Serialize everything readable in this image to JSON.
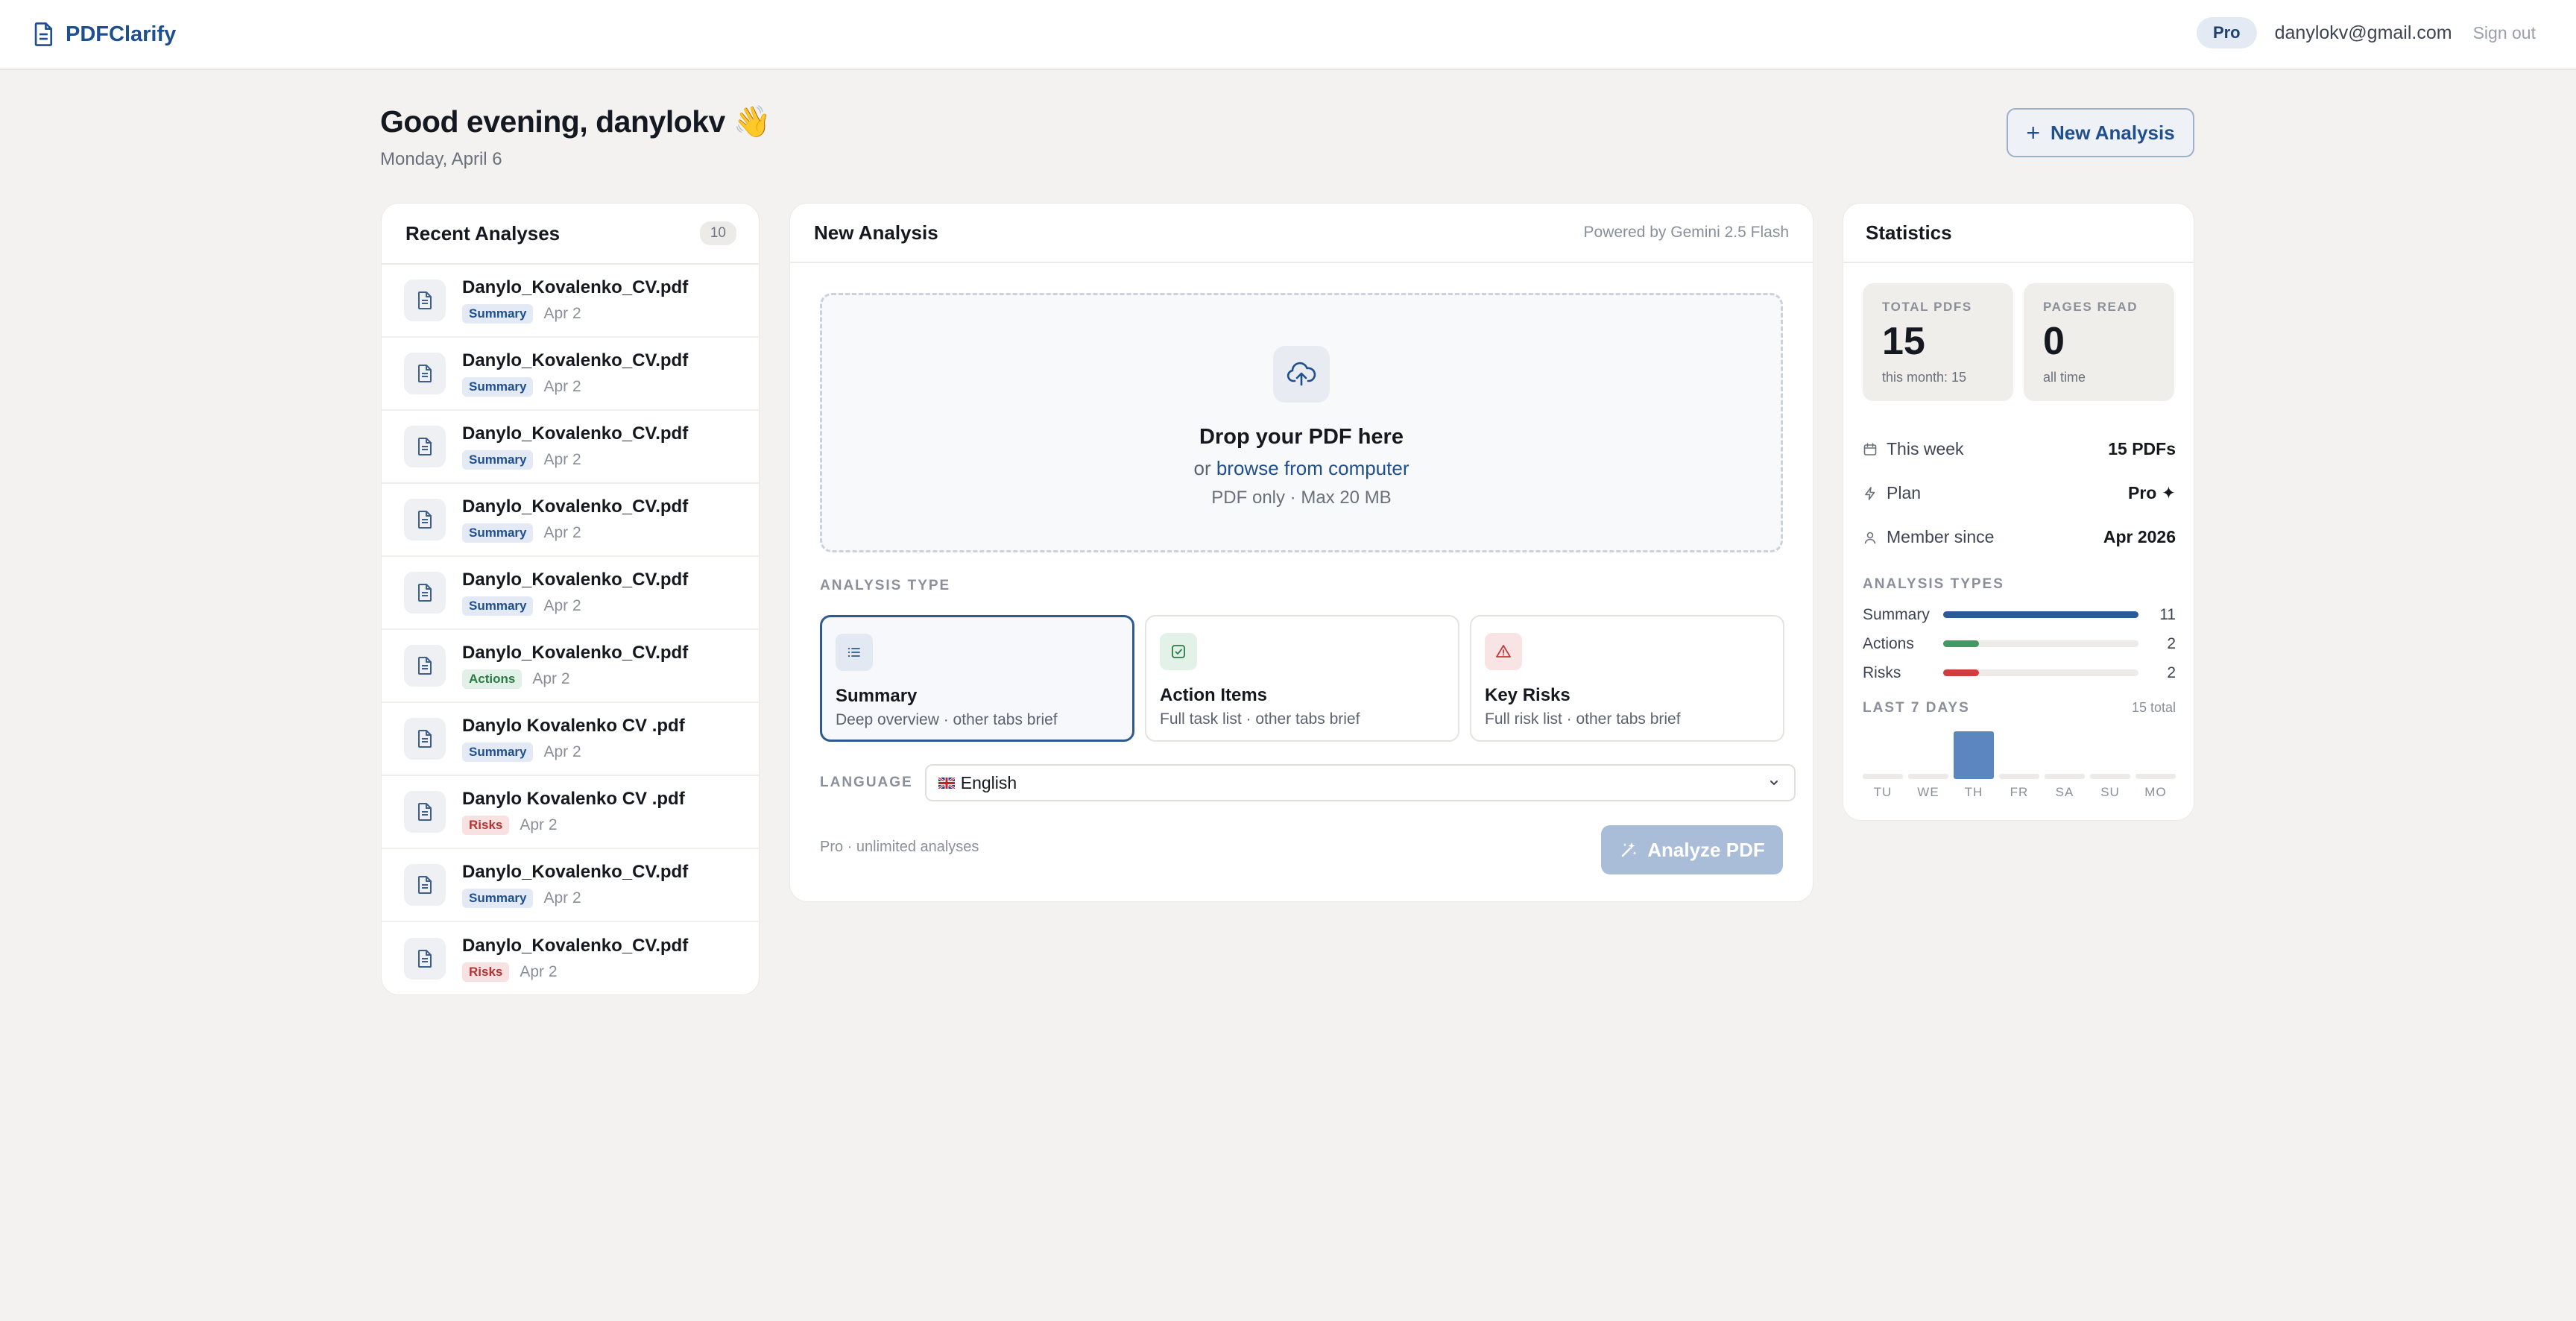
{
  "app": {
    "name": "PDFClarify"
  },
  "header": {
    "plan_badge": "Pro",
    "user_email": "danylokv@gmail.com",
    "sign_out": "Sign out"
  },
  "greeting": {
    "title": "Good evening, danylokv 👋",
    "date": "Monday, April 6"
  },
  "new_analysis_button": "New Analysis",
  "recent": {
    "title": "Recent Analyses",
    "count": "10",
    "items": [
      {
        "name": "Danylo_Kovalenko_CV.pdf",
        "tag": "Summary",
        "date": "Apr 2"
      },
      {
        "name": "Danylo_Kovalenko_CV.pdf",
        "tag": "Summary",
        "date": "Apr 2"
      },
      {
        "name": "Danylo_Kovalenko_CV.pdf",
        "tag": "Summary",
        "date": "Apr 2"
      },
      {
        "name": "Danylo_Kovalenko_CV.pdf",
        "tag": "Summary",
        "date": "Apr 2"
      },
      {
        "name": "Danylo_Kovalenko_CV.pdf",
        "tag": "Summary",
        "date": "Apr 2"
      },
      {
        "name": "Danylo_Kovalenko_CV.pdf",
        "tag": "Actions",
        "date": "Apr 2"
      },
      {
        "name": "Danylo Kovalenko CV .pdf",
        "tag": "Summary",
        "date": "Apr 2"
      },
      {
        "name": "Danylo Kovalenko CV .pdf",
        "tag": "Risks",
        "date": "Apr 2"
      },
      {
        "name": "Danylo_Kovalenko_CV.pdf",
        "tag": "Summary",
        "date": "Apr 2"
      },
      {
        "name": "Danylo_Kovalenko_CV.pdf",
        "tag": "Risks",
        "date": "Apr 2"
      }
    ]
  },
  "analysis": {
    "title": "New Analysis",
    "powered_by": "Powered by Gemini 2.5 Flash",
    "dropzone": {
      "title": "Drop your PDF here",
      "or": "or",
      "browse": "browse from computer",
      "hint": "PDF only · Max 20 MB"
    },
    "type_label": "ANALYSIS TYPE",
    "types": [
      {
        "name": "Summary",
        "desc": "Deep overview · other tabs brief",
        "icon": "list-icon",
        "selected": true
      },
      {
        "name": "Action Items",
        "desc": "Full task list · other tabs brief",
        "icon": "checkbox-icon",
        "selected": false
      },
      {
        "name": "Key Risks",
        "desc": "Full risk list · other tabs brief",
        "icon": "warning-icon",
        "selected": false
      }
    ],
    "language_label": "LANGUAGE",
    "language_value": "English",
    "plan_note": "Pro · unlimited analyses",
    "analyze_button": "Analyze PDF"
  },
  "stats": {
    "title": "Statistics",
    "total_pdfs": {
      "label": "TOTAL PDFS",
      "value": "15",
      "sub": "this month: 15"
    },
    "pages_read": {
      "label": "PAGES READ",
      "value": "0",
      "sub": "all time"
    },
    "rows": [
      {
        "label": "This week",
        "value": "15 PDFs",
        "icon": "calendar-icon"
      },
      {
        "label": "Plan",
        "value": "Pro ✦",
        "icon": "bolt-icon"
      },
      {
        "label": "Member since",
        "value": "Apr 2026",
        "icon": "user-icon"
      }
    ],
    "types_label": "ANALYSIS TYPES",
    "type_counts": [
      {
        "name": "Summary",
        "count": "11",
        "value": 11,
        "color": "#2b5a97"
      },
      {
        "name": "Actions",
        "count": "2",
        "value": 2,
        "color": "#3f9b63"
      },
      {
        "name": "Risks",
        "count": "2",
        "value": 2,
        "color": "#d13d3d"
      }
    ],
    "last7_label": "LAST 7 DAYS",
    "last7_total": "15 total",
    "days": [
      {
        "label": "TU",
        "value": 0
      },
      {
        "label": "WE",
        "value": 0
      },
      {
        "label": "TH",
        "value": 15
      },
      {
        "label": "FR",
        "value": 0
      },
      {
        "label": "SA",
        "value": 0
      },
      {
        "label": "SU",
        "value": 0
      },
      {
        "label": "MO",
        "value": 0
      }
    ]
  }
}
